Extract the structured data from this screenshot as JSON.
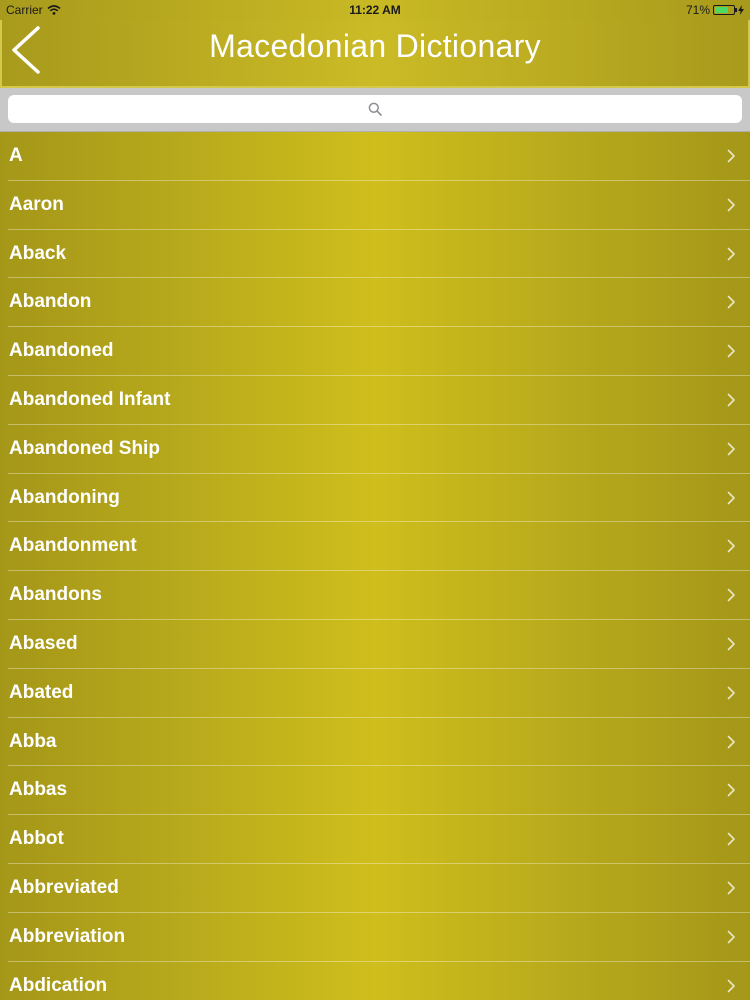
{
  "status": {
    "carrier": "Carrier",
    "time": "11:22 AM",
    "battery": "71%",
    "battery_level": 0.71,
    "icons": [
      "wifi-icon",
      "battery-icon",
      "charging-icon"
    ]
  },
  "nav": {
    "title": "Macedonian Dictionary",
    "back_icon": "chevron-left-icon"
  },
  "search": {
    "placeholder": "",
    "value": "",
    "icon": "search-icon"
  },
  "colors": {
    "accent": "#c4b520",
    "text": "#ffffff"
  },
  "list": {
    "row_icon": "chevron-right-icon",
    "items": [
      "A",
      "Aaron",
      "Aback",
      "Abandon",
      "Abandoned",
      "Abandoned Infant",
      "Abandoned Ship",
      "Abandoning",
      "Abandonment",
      "Abandons",
      "Abased",
      "Abated",
      "Abba",
      "Abbas",
      "Abbot",
      "Abbreviated",
      "Abbreviation",
      "Abdication"
    ]
  }
}
